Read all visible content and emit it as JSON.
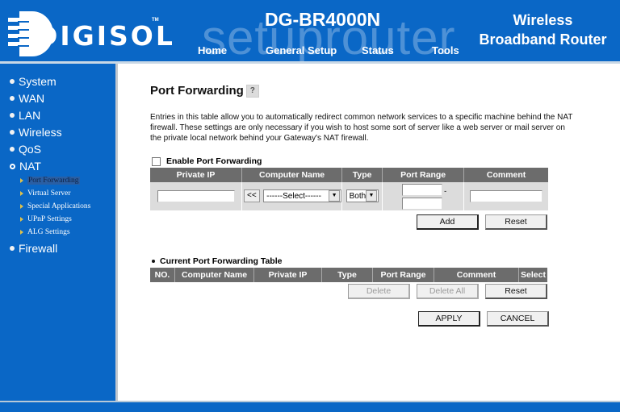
{
  "header": {
    "brand": "DIGISOL",
    "trademark": "TM",
    "model": "DG-BR4000N",
    "tagline_line1": "Wireless",
    "tagline_line2": "Broadband Router",
    "watermark": "setuprouter",
    "nav": [
      "Home",
      "General Setup",
      "Status",
      "Tools"
    ]
  },
  "sidebar": {
    "items": [
      {
        "label": "System",
        "icon": "bullet"
      },
      {
        "label": "WAN",
        "icon": "bullet"
      },
      {
        "label": "LAN",
        "icon": "bullet"
      },
      {
        "label": "Wireless",
        "icon": "bullet"
      },
      {
        "label": "QoS",
        "icon": "bullet"
      },
      {
        "label": "NAT",
        "icon": "open-bullet",
        "expanded": true
      },
      {
        "label": "Firewall",
        "icon": "bullet"
      }
    ],
    "nat_subitems": [
      {
        "label": "Port Forwarding",
        "active": true
      },
      {
        "label": "Virtual Server"
      },
      {
        "label": "Special Applications"
      },
      {
        "label": "UPnP Settings"
      },
      {
        "label": "ALG Settings"
      }
    ]
  },
  "main": {
    "title": "Port Forwarding",
    "help_icon": "?",
    "description": "Entries in this table allow you to automatically redirect common network services to a specific machine behind the NAT firewall. These settings are only necessary if you wish to host some sort of server like a web server or mail server on the private local network behind your Gateway's NAT firewall.",
    "enable_label": "Enable Port Forwarding",
    "enable_checked": false,
    "entry_table": {
      "headers": [
        "Private IP",
        "Computer Name",
        "Type",
        "Port Range",
        "Comment"
      ],
      "private_ip": "",
      "copy_button": "<<",
      "computer_name_selected": "------Select------",
      "type_selected": "Both",
      "port_from": "",
      "port_to": "",
      "port_separator": "-",
      "comment": ""
    },
    "add_button": "Add",
    "reset_button": "Reset",
    "current_table": {
      "title": "Current Port Forwarding Table",
      "headers": [
        "NO.",
        "Computer Name",
        "Private IP",
        "Type",
        "Port Range",
        "Comment",
        "Select"
      ],
      "rows": []
    },
    "delete_button": "Delete",
    "delete_all_button": "Delete All",
    "reset2_button": "Reset",
    "apply_button": "APPLY",
    "cancel_button": "CANCEL"
  }
}
